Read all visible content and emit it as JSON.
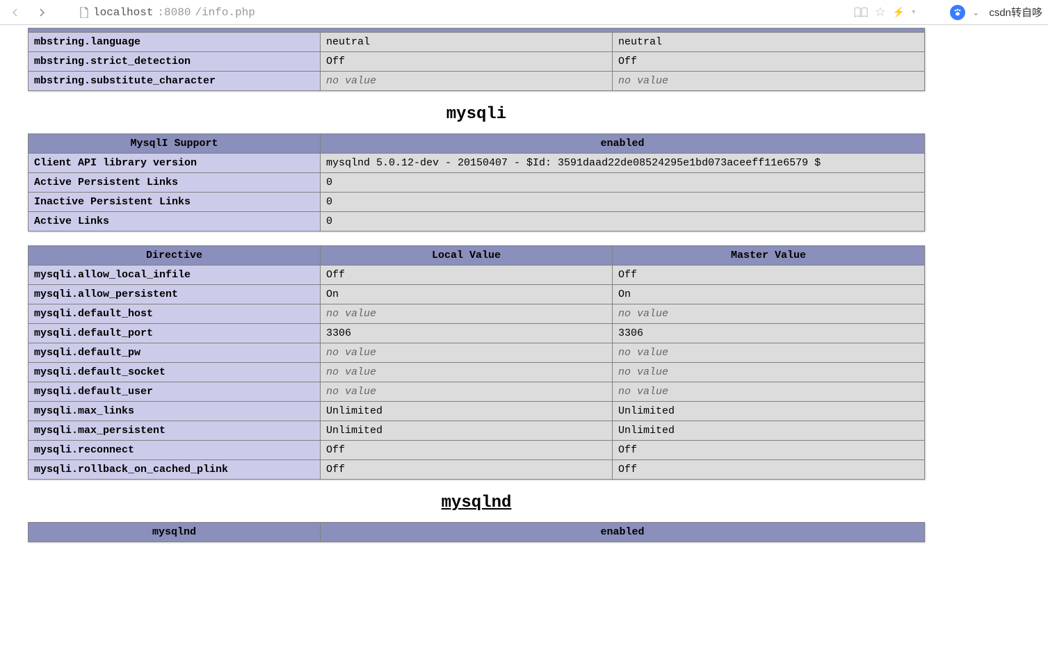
{
  "toolbar": {
    "url_host": "localhost",
    "url_port": ":8080",
    "url_path": "/info.php",
    "extension_text": "csdn转自哆"
  },
  "mbstring_rows": [
    {
      "name": "mbstring.language",
      "local": "neutral",
      "master": "neutral",
      "nv": false
    },
    {
      "name": "mbstring.strict_detection",
      "local": "Off",
      "master": "Off",
      "nv": false
    },
    {
      "name": "mbstring.substitute_character",
      "local": "no value",
      "master": "no value",
      "nv": true
    }
  ],
  "heading_mysqli": "mysqli",
  "mysqli_support": {
    "th1": "MysqlI Support",
    "th2": "enabled",
    "rows": [
      {
        "k": "Client API library version",
        "v": "mysqlnd 5.0.12-dev - 20150407 - $Id: 3591daad22de08524295e1bd073aceeff11e6579 $"
      },
      {
        "k": "Active Persistent Links",
        "v": "0"
      },
      {
        "k": "Inactive Persistent Links",
        "v": "0"
      },
      {
        "k": "Active Links",
        "v": "0"
      }
    ]
  },
  "mysqli_directives": {
    "th1": "Directive",
    "th2": "Local Value",
    "th3": "Master Value",
    "rows": [
      {
        "name": "mysqli.allow_local_infile",
        "local": "Off",
        "master": "Off",
        "nv": false
      },
      {
        "name": "mysqli.allow_persistent",
        "local": "On",
        "master": "On",
        "nv": false
      },
      {
        "name": "mysqli.default_host",
        "local": "no value",
        "master": "no value",
        "nv": true
      },
      {
        "name": "mysqli.default_port",
        "local": "3306",
        "master": "3306",
        "nv": false
      },
      {
        "name": "mysqli.default_pw",
        "local": "no value",
        "master": "no value",
        "nv": true
      },
      {
        "name": "mysqli.default_socket",
        "local": "no value",
        "master": "no value",
        "nv": true
      },
      {
        "name": "mysqli.default_user",
        "local": "no value",
        "master": "no value",
        "nv": true
      },
      {
        "name": "mysqli.max_links",
        "local": "Unlimited",
        "master": "Unlimited",
        "nv": false
      },
      {
        "name": "mysqli.max_persistent",
        "local": "Unlimited",
        "master": "Unlimited",
        "nv": false
      },
      {
        "name": "mysqli.reconnect",
        "local": "Off",
        "master": "Off",
        "nv": false
      },
      {
        "name": "mysqli.rollback_on_cached_plink",
        "local": "Off",
        "master": "Off",
        "nv": false
      }
    ]
  },
  "heading_mysqlnd": "mysqlnd",
  "mysqlnd_support": {
    "th1": "mysqlnd",
    "th2": "enabled"
  }
}
